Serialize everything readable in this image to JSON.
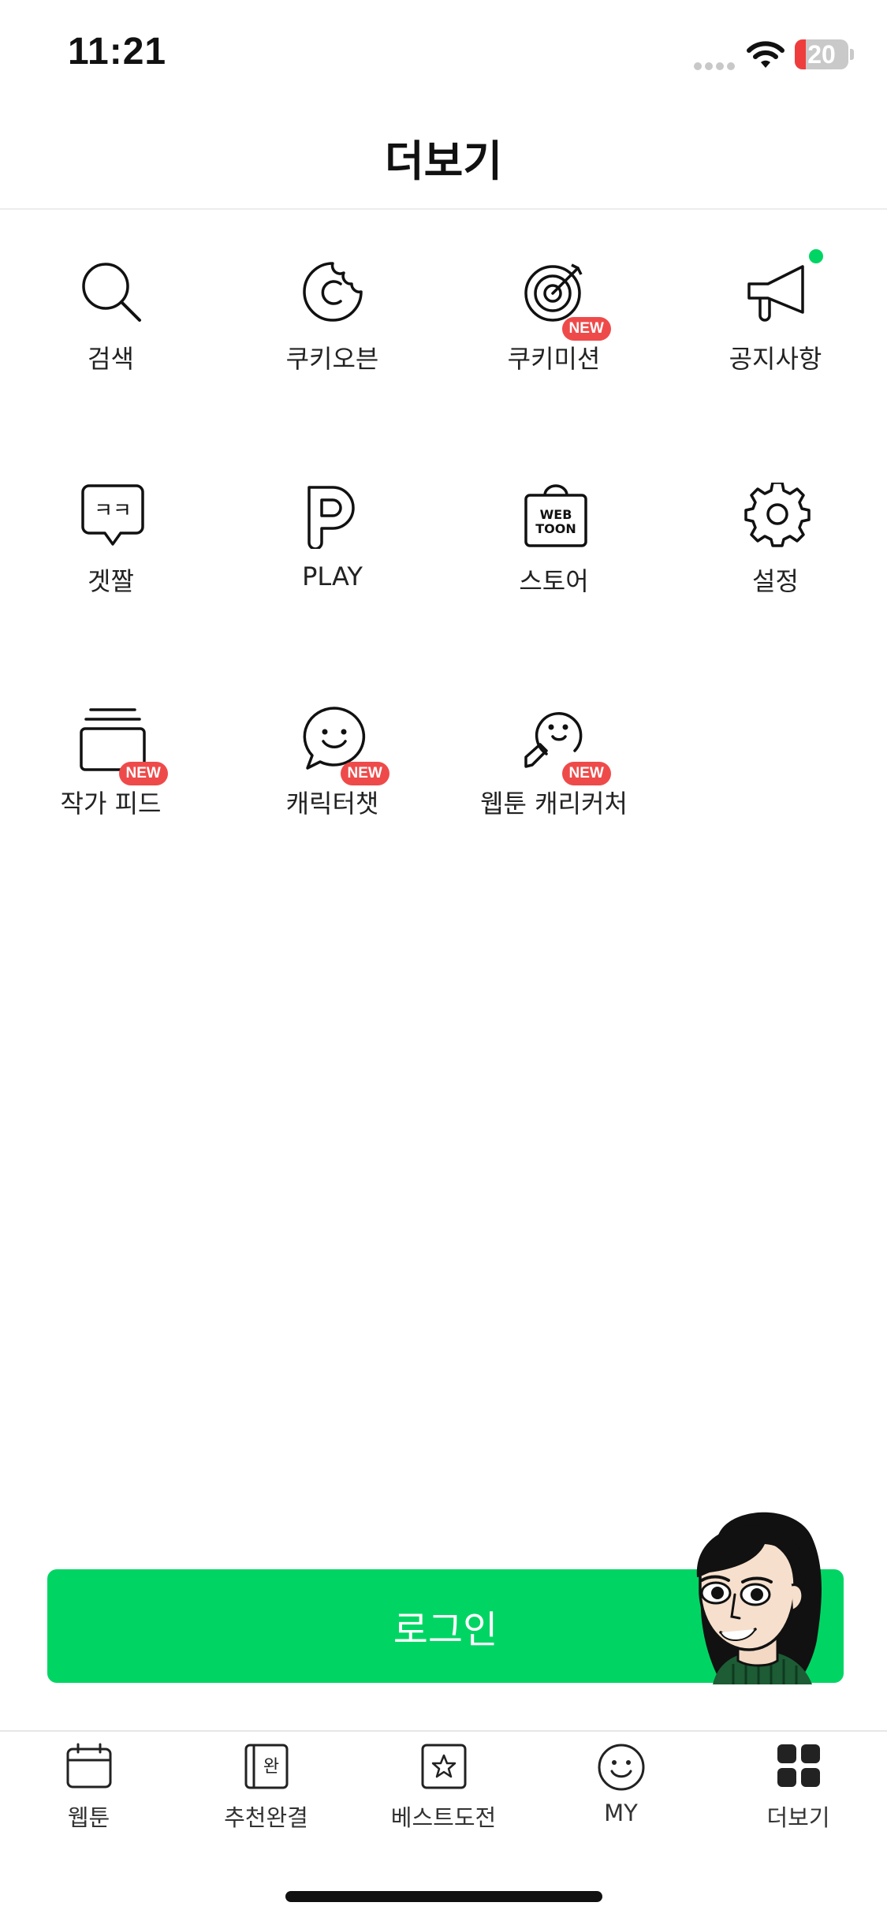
{
  "status_bar": {
    "time": "11:21",
    "battery_level": 20,
    "battery_text": "20"
  },
  "header": {
    "title": "더보기"
  },
  "menu": {
    "items": [
      {
        "label": "검색",
        "icon": "search-icon",
        "badge": ""
      },
      {
        "label": "쿠키오븐",
        "icon": "cookie-icon",
        "badge": ""
      },
      {
        "label": "쿠키미션",
        "icon": "target-icon",
        "badge": "NEW"
      },
      {
        "label": "공지사항",
        "icon": "megaphone-icon",
        "badge": "",
        "dot": true
      },
      {
        "label": "겟짤",
        "icon": "speech-bubble-icon",
        "badge": ""
      },
      {
        "label": "PLAY",
        "icon": "play-p-icon",
        "badge": ""
      },
      {
        "label": "스토어",
        "icon": "webtoon-bag-icon",
        "badge": "",
        "icon_text": "WEB TOON"
      },
      {
        "label": "설정",
        "icon": "gear-icon",
        "badge": ""
      },
      {
        "label": "작가 피드",
        "icon": "card-stack-icon",
        "badge": "NEW"
      },
      {
        "label": "캐릭터챗",
        "icon": "smile-chat-icon",
        "badge": "NEW"
      },
      {
        "label": "웹툰 캐리커처",
        "icon": "caricature-icon",
        "badge": "NEW"
      }
    ]
  },
  "login": {
    "label": "로그인"
  },
  "tabs": [
    {
      "label": "웹툰",
      "icon": "calendar-icon"
    },
    {
      "label": "추천완결",
      "icon": "book-icon",
      "icon_text": "완"
    },
    {
      "label": "베스트도전",
      "icon": "star-icon"
    },
    {
      "label": "MY",
      "icon": "smiley-icon"
    },
    {
      "label": "더보기",
      "icon": "grid-icon"
    }
  ],
  "colors": {
    "accent": "#00d564",
    "badge": "#ef4a4a",
    "battery_low": "#ef3d3d"
  }
}
